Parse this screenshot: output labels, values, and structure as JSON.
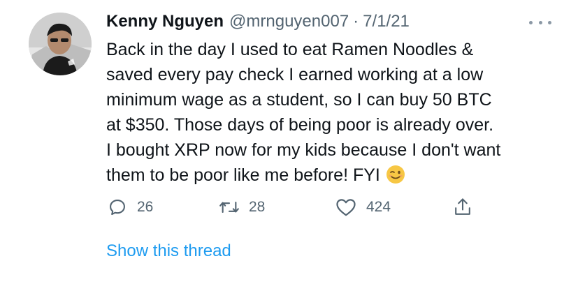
{
  "tweet": {
    "author_name": "Kenny Nguyen",
    "handle": "@mrnguyen007",
    "separator": "·",
    "date": "7/1/21",
    "lines": [
      "Back in the day I used to eat Ramen Noodles &",
      "saved every pay check I earned working at a low",
      "minimum wage as a student, so I can buy 50 BTC",
      "at $350. Those days of being poor is already over.",
      "I bought XRP now for my kids because I don't want",
      "them to be poor like me before! FYI"
    ],
    "emoji": "winking-face-emoji",
    "actions": {
      "reply_count": "26",
      "retweet_count": "28",
      "like_count": "424",
      "share_icon": "share-icon"
    },
    "show_thread_label": "Show this thread"
  },
  "colors": {
    "text": "#0f1419",
    "secondary": "#536471",
    "link": "#1d9bf0",
    "emoji": "#f7c744"
  }
}
